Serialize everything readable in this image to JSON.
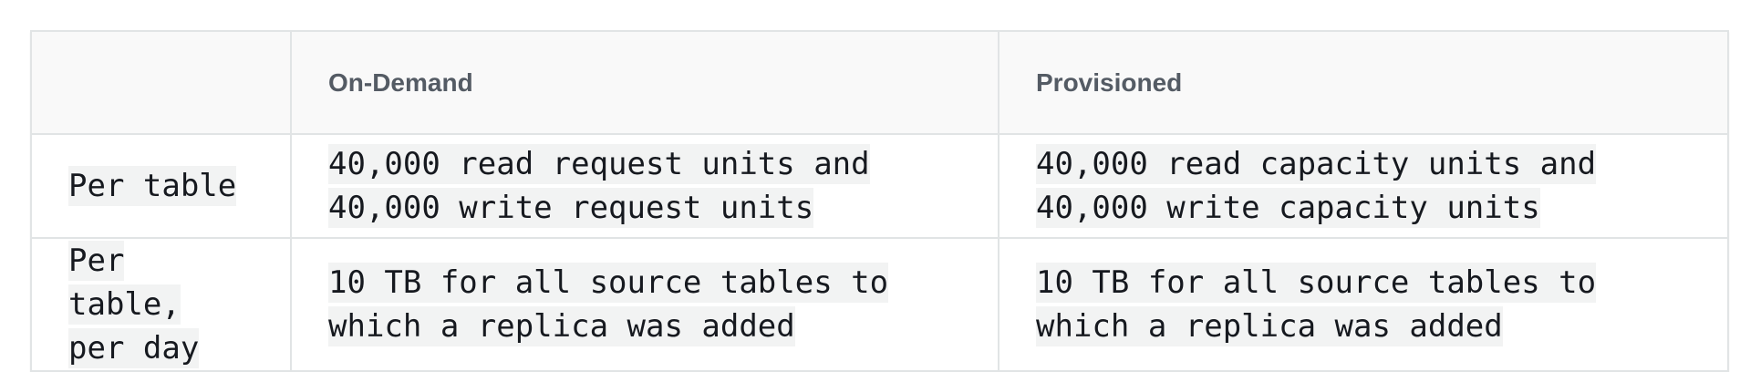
{
  "table": {
    "headers": [
      "",
      "On-Demand",
      "Provisioned"
    ],
    "rows": [
      {
        "label": "Per table",
        "on_demand": "40,000 read request units and 40,000 write request units",
        "provisioned": "40,000 read capacity units and 40,000 write capacity units"
      },
      {
        "label": "Per table, per day",
        "on_demand": "10 TB for all source tables to which a replica was added",
        "provisioned": "10 TB for all source tables to which a replica was added"
      }
    ]
  }
}
